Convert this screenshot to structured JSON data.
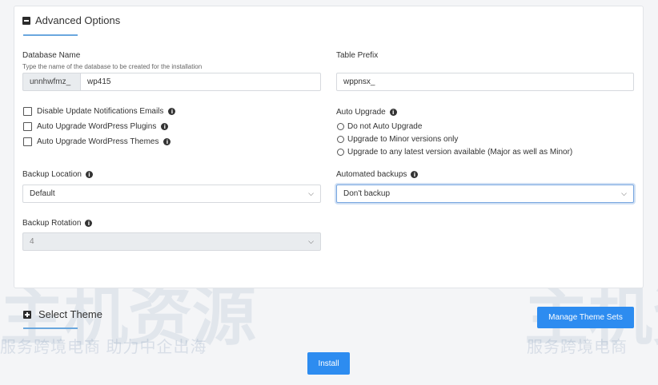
{
  "advanced": {
    "title": "Advanced Options",
    "db_name_label": "Database Name",
    "db_name_hint": "Type the name of the database to be created for the installation",
    "db_prefix": "unnhwfmz_",
    "db_name_value": "wp415",
    "table_prefix_label": "Table Prefix",
    "table_prefix_value": "wppnsx_",
    "checkboxes": [
      {
        "label": "Disable Update Notifications Emails",
        "checked": false
      },
      {
        "label": "Auto Upgrade WordPress Plugins",
        "checked": false
      },
      {
        "label": "Auto Upgrade WordPress Themes",
        "checked": false
      }
    ],
    "auto_upgrade_label": "Auto Upgrade",
    "auto_upgrade_options": [
      "Do not Auto Upgrade",
      "Upgrade to Minor versions only",
      "Upgrade to any latest version available (Major as well as Minor)"
    ],
    "backup_location_label": "Backup Location",
    "backup_location_value": "Default",
    "automated_backups_label": "Automated backups",
    "automated_backups_value": "Don't backup",
    "backup_rotation_label": "Backup Rotation",
    "backup_rotation_value": "4"
  },
  "select_theme": {
    "title": "Select Theme",
    "manage_button": "Manage Theme Sets"
  },
  "install_button": "Install",
  "watermark": {
    "main": "主机资源",
    "sub": "服务跨境电商 助力中企出海",
    "sub2": "服务跨境电商",
    "sub3": "服务跨境电商 助力中企出海"
  },
  "colors": {
    "accent": "#2d8cf0",
    "underline": "#6aa7de"
  }
}
